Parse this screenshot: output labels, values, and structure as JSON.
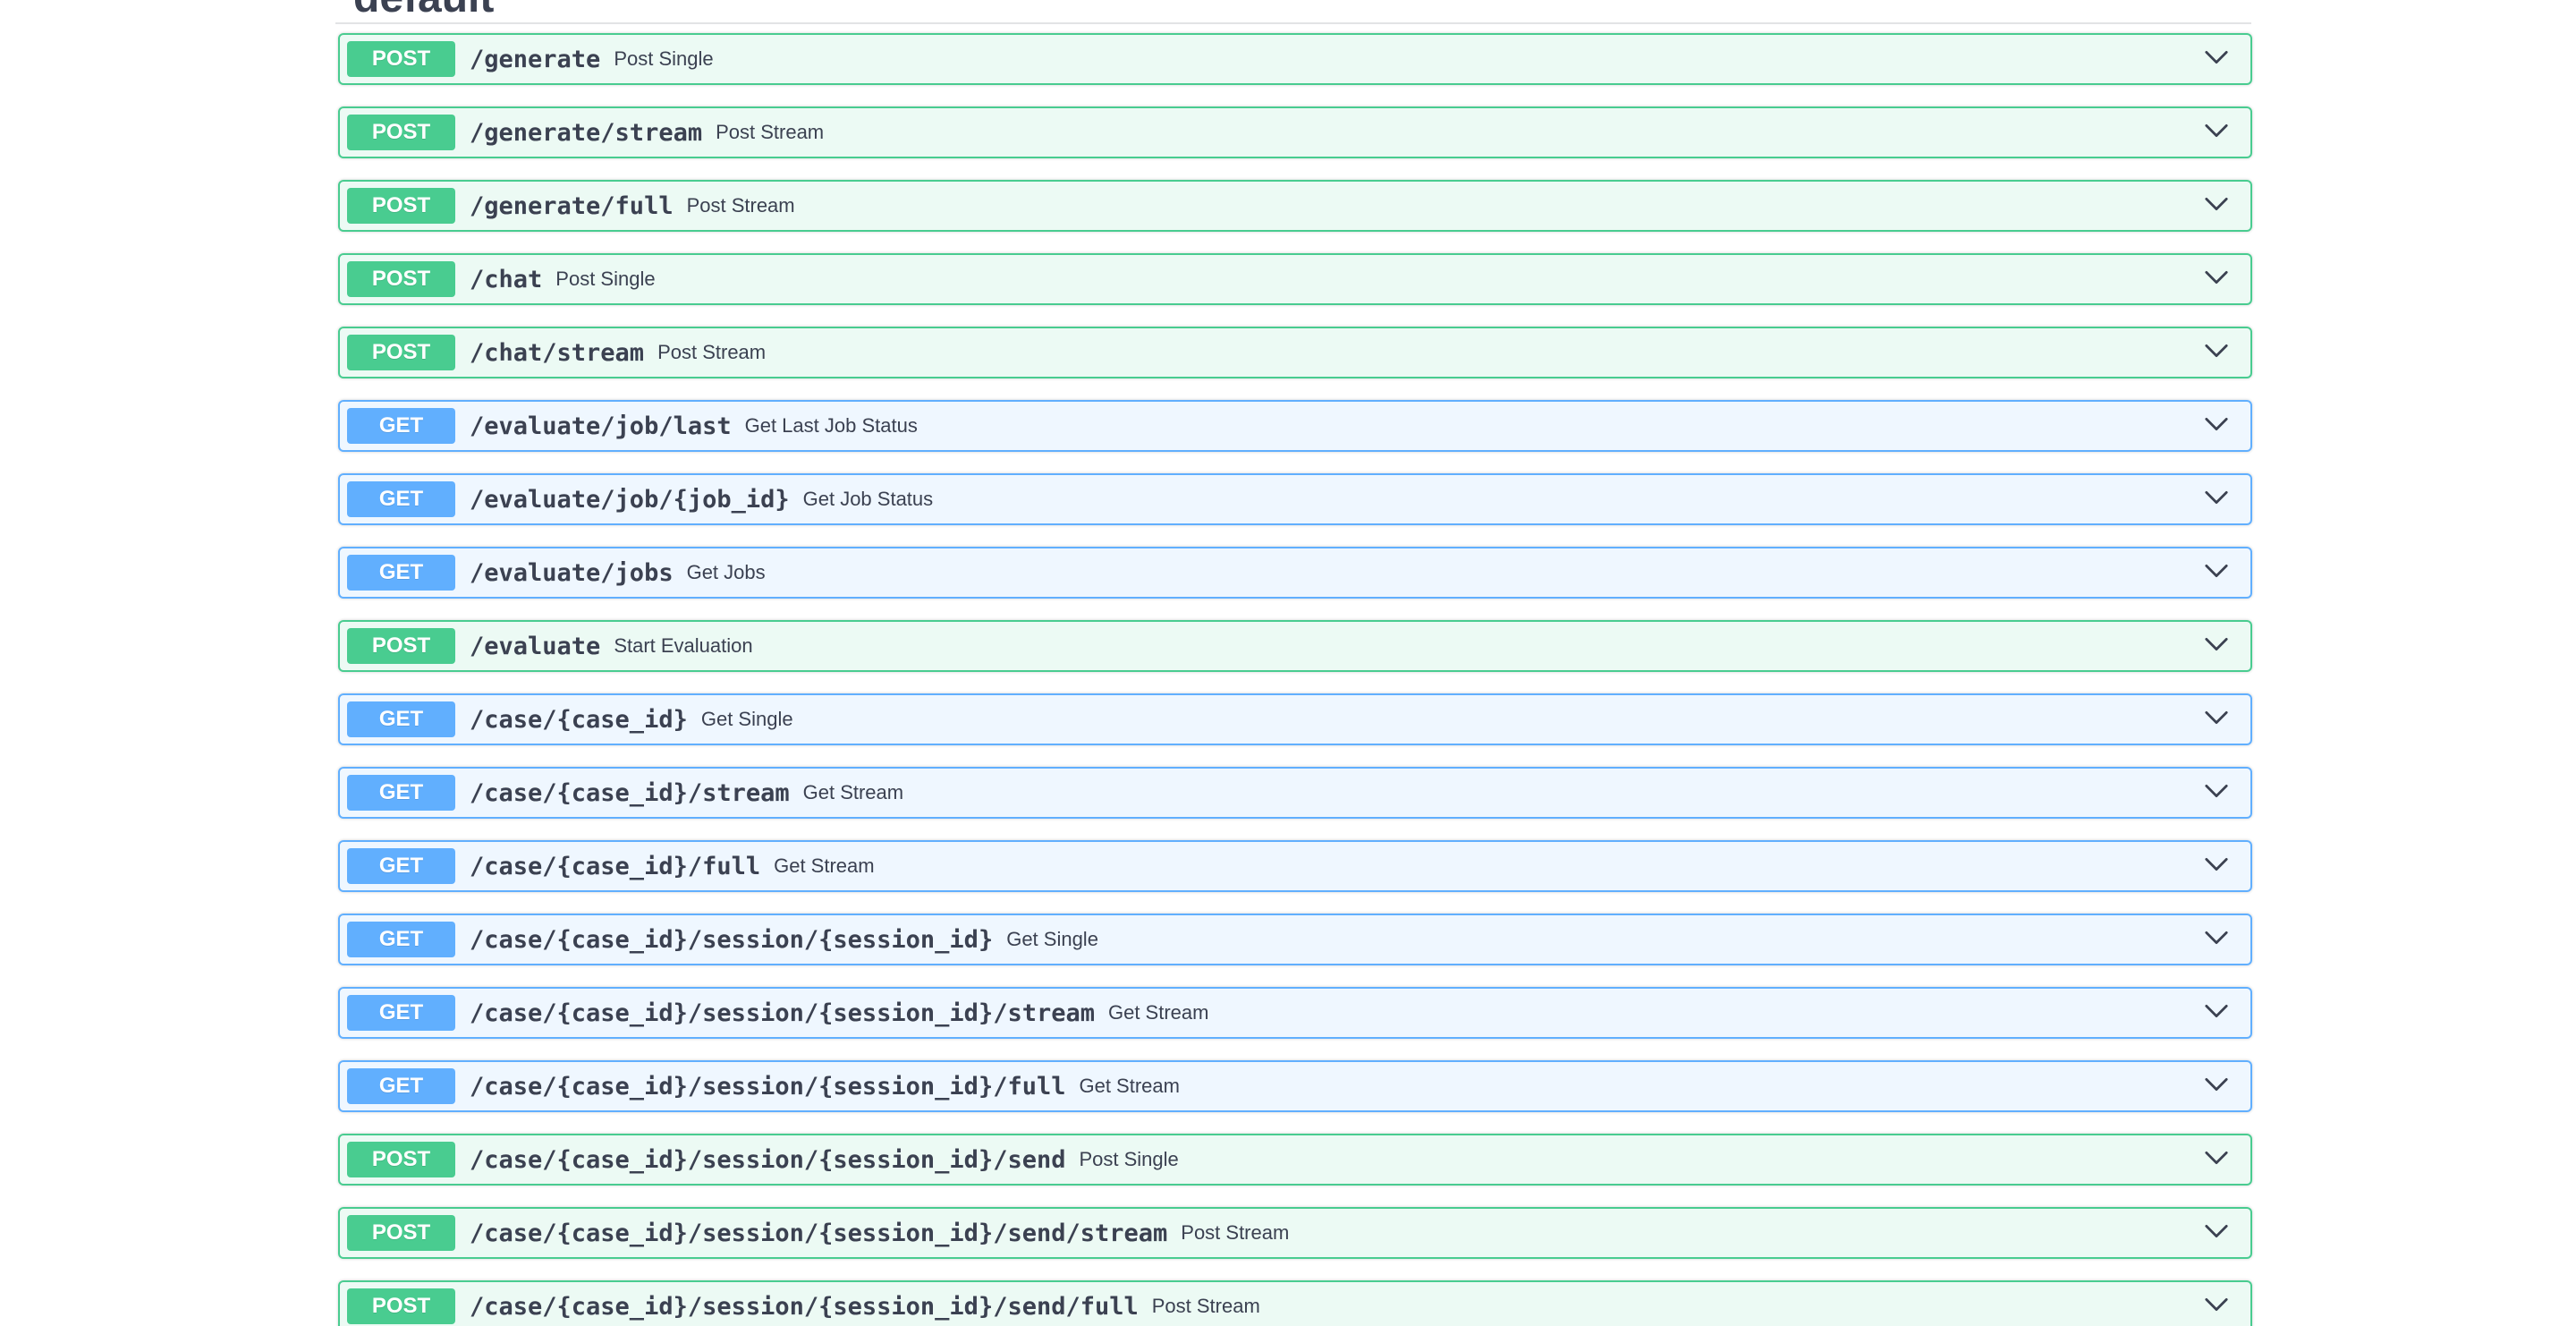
{
  "section": {
    "title": "default"
  },
  "operations": [
    {
      "method": "POST",
      "path": "/generate",
      "summary": "Post Single"
    },
    {
      "method": "POST",
      "path": "/generate/stream",
      "summary": "Post Stream"
    },
    {
      "method": "POST",
      "path": "/generate/full",
      "summary": "Post Stream"
    },
    {
      "method": "POST",
      "path": "/chat",
      "summary": "Post Single"
    },
    {
      "method": "POST",
      "path": "/chat/stream",
      "summary": "Post Stream"
    },
    {
      "method": "GET",
      "path": "/evaluate/job/last",
      "summary": "Get Last Job Status"
    },
    {
      "method": "GET",
      "path": "/evaluate/job/{job_id}",
      "summary": "Get Job Status"
    },
    {
      "method": "GET",
      "path": "/evaluate/jobs",
      "summary": "Get Jobs"
    },
    {
      "method": "POST",
      "path": "/evaluate",
      "summary": "Start Evaluation"
    },
    {
      "method": "GET",
      "path": "/case/{case_id}",
      "summary": "Get Single"
    },
    {
      "method": "GET",
      "path": "/case/{case_id}/stream",
      "summary": "Get Stream"
    },
    {
      "method": "GET",
      "path": "/case/{case_id}/full",
      "summary": "Get Stream"
    },
    {
      "method": "GET",
      "path": "/case/{case_id}/session/{session_id}",
      "summary": "Get Single"
    },
    {
      "method": "GET",
      "path": "/case/{case_id}/session/{session_id}/stream",
      "summary": "Get Stream"
    },
    {
      "method": "GET",
      "path": "/case/{case_id}/session/{session_id}/full",
      "summary": "Get Stream"
    },
    {
      "method": "POST",
      "path": "/case/{case_id}/session/{session_id}/send",
      "summary": "Post Single"
    },
    {
      "method": "POST",
      "path": "/case/{case_id}/session/{session_id}/send/stream",
      "summary": "Post Stream"
    },
    {
      "method": "POST",
      "path": "/case/{case_id}/session/{session_id}/send/full",
      "summary": "Post Stream"
    }
  ],
  "icons": {
    "expand": "chevron-down-icon"
  },
  "colors": {
    "post": "#49cc90",
    "get": "#61affe",
    "text": "#3b4151"
  }
}
